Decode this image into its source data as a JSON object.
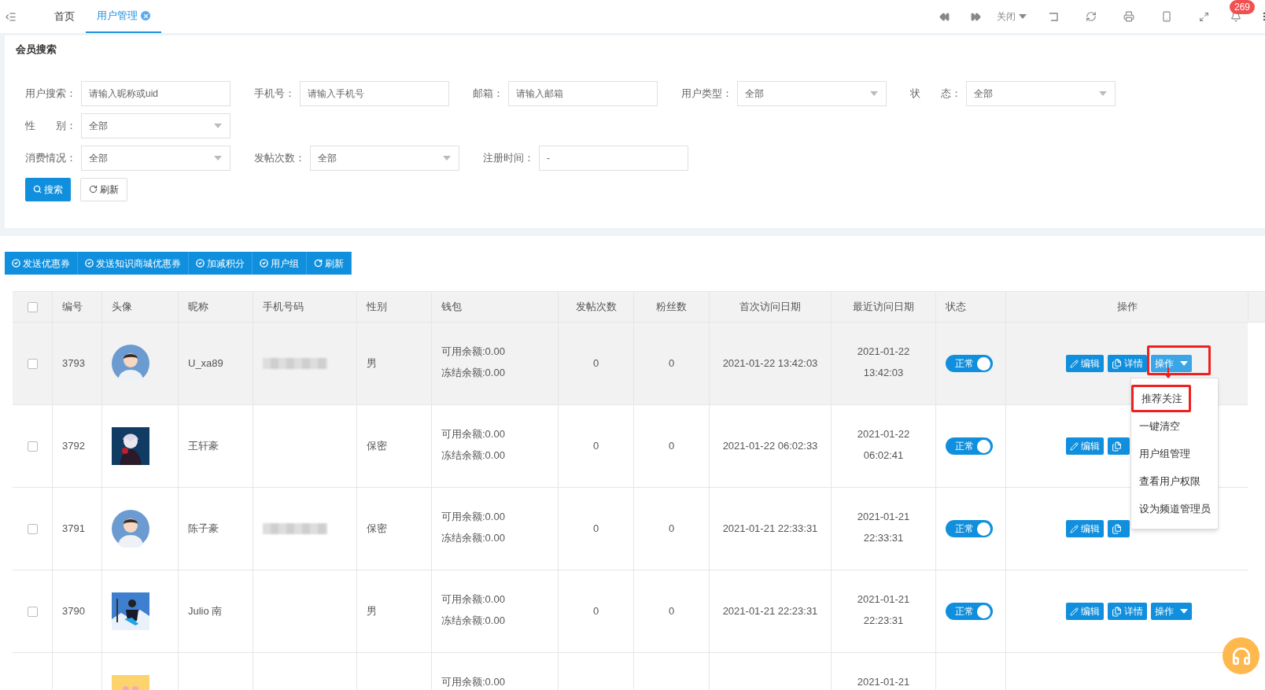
{
  "tabs": [
    {
      "label": "首页",
      "selected": false,
      "closable": false
    },
    {
      "label": "用户管理",
      "selected": true,
      "closable": true
    }
  ],
  "top_bar": {
    "close_menu": "关闭",
    "notifications": "269"
  },
  "search_panel": {
    "title": "会员搜索",
    "rows": [
      [
        {
          "kind": "input",
          "label": "用户搜索：",
          "placeholder": "请输入昵称或uid"
        },
        {
          "kind": "input",
          "label": "手机号：",
          "placeholder": "请输入手机号"
        },
        {
          "kind": "input",
          "label": "邮箱：",
          "placeholder": "请输入邮箱"
        },
        {
          "kind": "select",
          "label": "用户类型：",
          "value": "全部"
        },
        {
          "kind": "select",
          "label": "状　　态：",
          "value": "全部"
        }
      ],
      [
        {
          "kind": "select",
          "label": "性　　别：",
          "value": "全部"
        }
      ],
      [
        {
          "kind": "select",
          "label": "消费情况：",
          "value": "全部"
        },
        {
          "kind": "select",
          "label": "发帖次数：",
          "value": "全部"
        },
        {
          "kind": "input",
          "label": "注册时间：",
          "value": "-"
        }
      ]
    ],
    "buttons": [
      {
        "kind": "search",
        "label": "搜索"
      },
      {
        "kind": "refresh",
        "label": "刷新"
      }
    ]
  },
  "toolbar": [
    {
      "kind": "check",
      "label": "发送优惠券"
    },
    {
      "kind": "check",
      "label": "发送知识商城优惠券"
    },
    {
      "kind": "check",
      "label": "加减积分"
    },
    {
      "kind": "check",
      "label": "用户组"
    },
    {
      "kind": "refresh",
      "label": "刷新"
    }
  ],
  "table": {
    "select_all": {
      "checked": false
    },
    "columns": [
      "编号",
      "头像",
      "昵称",
      "手机号码",
      "性别",
      "钱包",
      "发帖次数",
      "粉丝数",
      "首次访问日期",
      "最近访问日期",
      "状态",
      "操作"
    ],
    "rows": [
      {
        "highlighted": true,
        "checked": false,
        "id": "3793",
        "avatar": {
          "kind": "silhouette"
        },
        "nickname": "U_xa89",
        "phone_masked": true,
        "gender": "男",
        "wallet": [
          "可用余额:0.00",
          "冻结余额:0.00"
        ],
        "posts": "0",
        "fans": "0",
        "first_visit": "2021-01-22 13:42:03",
        "last_visit": [
          "2021-01-22",
          "13:42:03"
        ],
        "status": {
          "label": "正常",
          "on": true
        },
        "actions": [
          {
            "kind": "edit",
            "label": "编辑"
          },
          {
            "kind": "detail",
            "label": "详情"
          },
          {
            "kind": "menu",
            "label": "操作",
            "highlighted": true,
            "expanded": true
          }
        ],
        "menu": [
          {
            "label": "推荐关注",
            "highlighted": true
          },
          {
            "label": "一键清空",
            "highlighted": false
          },
          {
            "label": "用户组管理",
            "highlighted": false
          },
          {
            "label": "查看用户权限",
            "highlighted": false
          },
          {
            "label": "设为频道管理员",
            "highlighted": false
          }
        ]
      },
      {
        "highlighted": false,
        "checked": false,
        "id": "3792",
        "avatar": {
          "kind": "dark"
        },
        "nickname": "王轩豪",
        "phone_masked": false,
        "gender": "保密",
        "wallet": [
          "可用余额:0.00",
          "冻结余额:0.00"
        ],
        "posts": "0",
        "fans": "0",
        "first_visit": "2021-01-22 06:02:33",
        "last_visit": [
          "2021-01-22",
          "06:02:41"
        ],
        "status": {
          "label": "正常",
          "on": true
        },
        "actions": [
          {
            "kind": "edit",
            "label": "编辑"
          },
          {
            "kind": "detail"
          }
        ]
      },
      {
        "highlighted": false,
        "checked": false,
        "id": "3791",
        "avatar": {
          "kind": "silhouette"
        },
        "nickname": "陈子豪",
        "phone_masked": true,
        "gender": "保密",
        "wallet": [
          "可用余额:0.00",
          "冻结余额:0.00"
        ],
        "posts": "0",
        "fans": "0",
        "first_visit": "2021-01-21 22:33:31",
        "last_visit": [
          "2021-01-21",
          "22:33:31"
        ],
        "status": {
          "label": "正常",
          "on": true
        },
        "actions": [
          {
            "kind": "edit",
            "label": "编辑"
          },
          {
            "kind": "detail"
          }
        ]
      },
      {
        "highlighted": false,
        "checked": false,
        "id": "3790",
        "avatar": {
          "kind": "snow"
        },
        "nickname": "Julio 南",
        "phone_masked": false,
        "gender": "男",
        "wallet": [
          "可用余额:0.00",
          "冻结余额:0.00"
        ],
        "posts": "0",
        "fans": "0",
        "first_visit": "2021-01-21 22:23:31",
        "last_visit": [
          "2021-01-21",
          "22:23:31"
        ],
        "status": {
          "label": "正常",
          "on": true
        },
        "actions": [
          {
            "kind": "edit",
            "label": "编辑"
          },
          {
            "kind": "detail",
            "label": "详情"
          },
          {
            "kind": "menu",
            "label": "操作",
            "highlighted": false,
            "expanded": false
          }
        ]
      },
      {
        "highlighted": false,
        "avatar": {
          "kind": "yellow"
        },
        "wallet": [
          "可用余额:0.00"
        ],
        "last_visit": [
          "2021-01-21"
        ]
      }
    ]
  }
}
